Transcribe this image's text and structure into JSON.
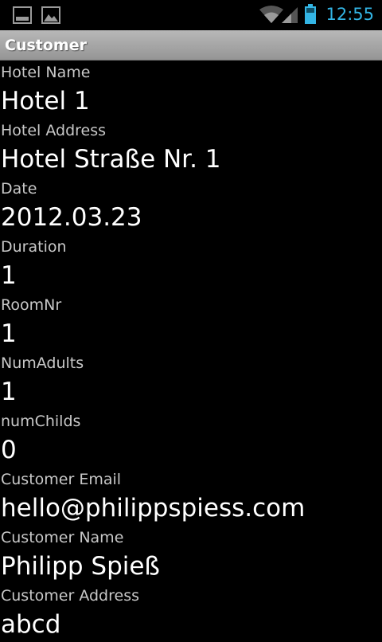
{
  "status_bar": {
    "time": "12:55",
    "icons": [
      "screenshot-icon",
      "gallery-icon",
      "wifi-icon",
      "signal-icon",
      "battery-icon"
    ],
    "accent_color": "#33b5e5"
  },
  "title_bar": {
    "title": "Customer"
  },
  "fields": [
    {
      "label": "Hotel Name",
      "value": "Hotel 1"
    },
    {
      "label": "Hotel Address",
      "value": "Hotel Straße Nr. 1"
    },
    {
      "label": "Date",
      "value": "2012.03.23"
    },
    {
      "label": "Duration",
      "value": "1"
    },
    {
      "label": "RoomNr",
      "value": "1"
    },
    {
      "label": "NumAdults",
      "value": "1"
    },
    {
      "label": "numChilds",
      "value": "0"
    },
    {
      "label": "Customer Email",
      "value": "hello@philippspiess.com"
    },
    {
      "label": "Customer Name",
      "value": "Philipp Spieß"
    },
    {
      "label": "Customer Address",
      "value": "abcd"
    }
  ]
}
